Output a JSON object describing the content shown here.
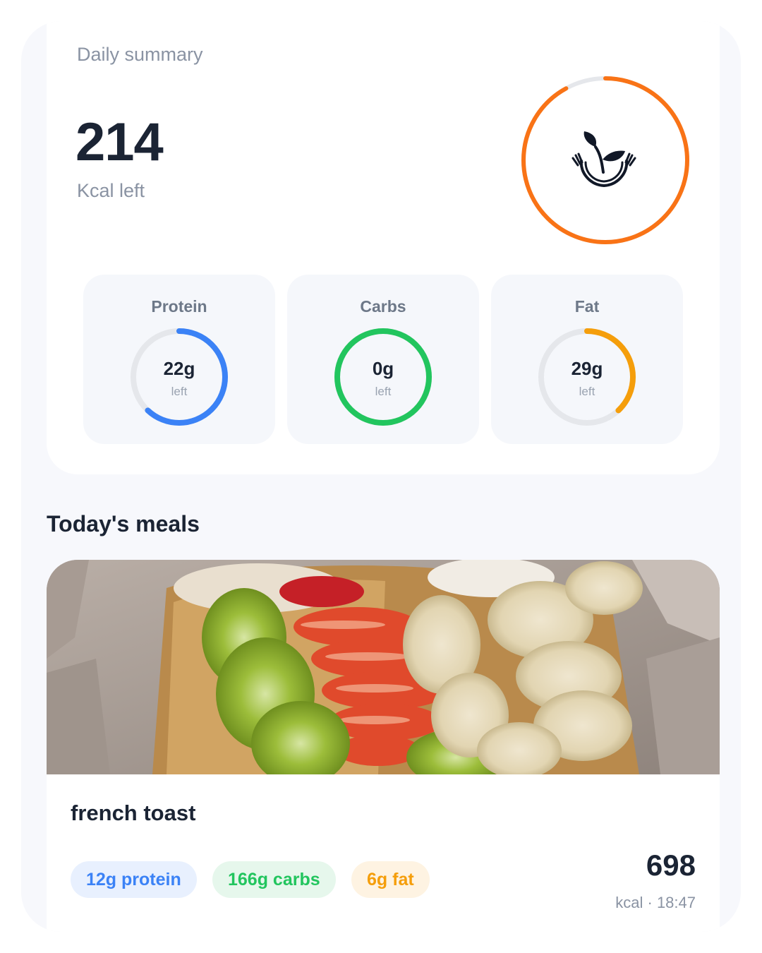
{
  "summary": {
    "title": "Daily summary",
    "kcal_left": "214",
    "kcal_left_label": "Kcal left",
    "kcal_ring_progress": 0.92,
    "colors": {
      "accent": "#f97316",
      "track": "#e5e7eb"
    },
    "logo_icon": "leaf-hands-icon"
  },
  "macros": [
    {
      "key": "protein",
      "title": "Protein",
      "value": "22g",
      "sub": "left",
      "progress": 0.62,
      "color": "#3b82f6"
    },
    {
      "key": "carbs",
      "title": "Carbs",
      "value": "0g",
      "sub": "left",
      "progress": 1.0,
      "color": "#22c55e"
    },
    {
      "key": "fat",
      "title": "Fat",
      "value": "29g",
      "sub": "left",
      "progress": 0.38,
      "color": "#f59e0b"
    }
  ],
  "meals": {
    "heading": "Today's meals",
    "items": [
      {
        "name": "french toast",
        "photo": "french-toast-with-kiwi-strawberry-banana-photo",
        "chips": {
          "protein": "12g protein",
          "carbs": "166g carbs",
          "fat": "6g fat"
        },
        "kcal": "698",
        "meta": "kcal · 18:47"
      }
    ]
  }
}
